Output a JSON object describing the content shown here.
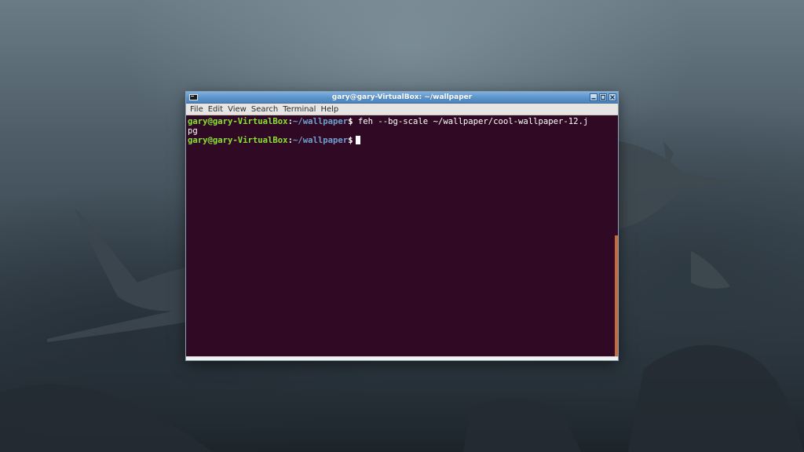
{
  "window": {
    "title": "gary@gary-VirtualBox: ~/wallpaper",
    "app_icon": "terminal-icon",
    "controls": [
      "minimize-icon",
      "maximize-icon",
      "close-icon"
    ]
  },
  "menubar": {
    "items": [
      {
        "label": "File"
      },
      {
        "label": "Edit"
      },
      {
        "label": "View"
      },
      {
        "label": "Search"
      },
      {
        "label": "Terminal"
      },
      {
        "label": "Help"
      }
    ]
  },
  "terminal": {
    "lines": [
      {
        "user_host": "gary@gary-VirtualBox",
        "sep": ":",
        "path": "~/wallpaper",
        "symbol": "$",
        "command": " feh --bg-scale ~/wallpaper/cool-wallpaper-12.j"
      },
      {
        "continuation": "pg"
      },
      {
        "user_host": "gary@gary-VirtualBox",
        "sep": ":",
        "path": "~/wallpaper",
        "symbol": "$",
        "command": ""
      }
    ],
    "colors": {
      "background": "#300a24",
      "user_host": "#8ae234",
      "path": "#729fcf",
      "text": "#ffffff"
    }
  },
  "colors": {
    "titlebar": "#5b93c9",
    "menubar": "#e6e5e3",
    "scrollbar_thumb": "#c76a3a"
  }
}
